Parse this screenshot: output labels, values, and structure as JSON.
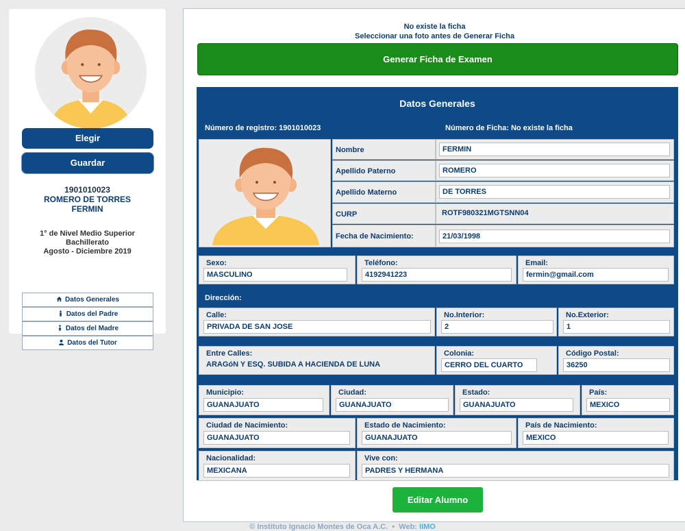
{
  "sidebar": {
    "choose_button": "Elegir",
    "save_button": "Guardar",
    "student_id": "1901010023",
    "student_lastname": "ROMERO DE TORRES",
    "student_firstname": "FERMIN",
    "level": "1° de Nivel Medio Superior",
    "program": "Bachillerato",
    "period": "Agosto - Diciembre 2019",
    "nav": [
      {
        "label": "Datos Generales",
        "icon": "home-icon"
      },
      {
        "label": "Datos del Padre",
        "icon": "male-icon"
      },
      {
        "label": "Datos del Madre",
        "icon": "female-icon"
      },
      {
        "label": "Datos del Tutor",
        "icon": "user-icon"
      }
    ]
  },
  "main": {
    "message_1": "No existe la ficha",
    "message_2": "Seleccionar una foto antes de Generar Ficha",
    "generate_button": "Generar Ficha de Examen",
    "card_title": "Datos Generales",
    "registro": "Número de registro: 1901010023",
    "ficha": "Número de Ficha: No existe la ficha",
    "fields": {
      "nombre": {
        "label": "Nombre",
        "value": "FERMIN"
      },
      "apellido_paterno": {
        "label": "Apellido Paterno",
        "value": "ROMERO"
      },
      "apellido_materno": {
        "label": "Apellido Materno",
        "value": "DE TORRES"
      },
      "curp": {
        "label": "CURP",
        "value": "ROTF980321MGTSNN04"
      },
      "fecha_nacimiento": {
        "label": "Fecha de Nacimiento:",
        "value": "21/03/1998"
      },
      "sexo": {
        "label": "Sexo:",
        "value": "MASCULINO"
      },
      "telefono": {
        "label": "Teléfono:",
        "value": "4192941223"
      },
      "email": {
        "label": "Email:",
        "value": "fermin@gmail.com"
      }
    },
    "direccion_label": "Dirección:",
    "address": {
      "calle": {
        "label": "Calle:",
        "value": "PRIVADA DE SAN JOSE"
      },
      "no_interior": {
        "label": "No.Interior:",
        "value": "2"
      },
      "no_exterior": {
        "label": "No.Exterior:",
        "value": "1"
      },
      "entre_calles": {
        "label": "Entre Calles:",
        "value": "ARAGóN Y ESQ. SUBIDA A HACIENDA DE LUNA"
      },
      "colonia": {
        "label": "Colonia:",
        "value": "CERRO DEL CUARTO"
      },
      "codigo_postal": {
        "label": "Código Postal:",
        "value": "36250"
      },
      "municipio": {
        "label": "Municipio:",
        "value": "GUANAJUATO"
      },
      "ciudad": {
        "label": "Ciudad:",
        "value": "GUANAJUATO"
      },
      "estado": {
        "label": "Estado:",
        "value": "GUANAJUATO"
      },
      "pais": {
        "label": "País:",
        "value": "MEXICO"
      },
      "ciudad_nacimiento": {
        "label": "Ciudad de Nacimiento:",
        "value": "GUANAJUATO"
      },
      "estado_nacimiento": {
        "label": "Estado de Nacimiento:",
        "value": "GUANAJUATO"
      },
      "pais_nacimiento": {
        "label": "País de Nacimiento:",
        "value": "MEXICO"
      },
      "nacionalidad": {
        "label": "Nacionalidad:",
        "value": "MEXICANA"
      },
      "vive_con": {
        "label": "Vive con:",
        "value": "PADRES Y HERMANA"
      }
    },
    "edit_button": "Editar Alumno"
  },
  "footer": {
    "text": "© Instituto Ignacio Montes de Oca A.C.",
    "separator": "•",
    "web_label": "Web:",
    "web_link": "IIMO"
  },
  "colors": {
    "primary": "#0d4a87",
    "generate": "#1a8c1a",
    "edit": "#1cb33c"
  }
}
